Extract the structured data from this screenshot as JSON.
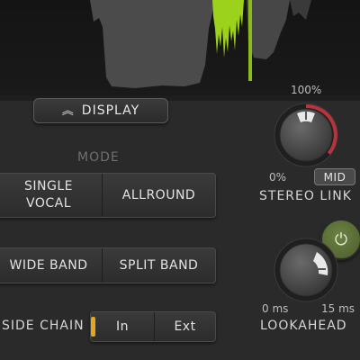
{
  "display": {
    "label": "DISPLAY",
    "icon": "double-chevron-up-icon"
  },
  "mode": {
    "title": "MODE",
    "options": [
      "SINGLE\nVOCAL",
      "ALLROUND"
    ]
  },
  "band": {
    "options": [
      "WIDE BAND",
      "SPLIT BAND"
    ]
  },
  "side_chain": {
    "label": "SIDE CHAIN",
    "options": [
      "In",
      "Ext"
    ],
    "selected": "In"
  },
  "stereo_link": {
    "max_label": "100%",
    "min_label": "0%",
    "mid_label": "MID",
    "label": "STEREO LINK",
    "value_fraction": 0.5
  },
  "lookahead": {
    "min_label": "0 ms",
    "max_label": "15 ms",
    "label": "LOOKAHEAD",
    "value_fraction": 1.0,
    "power_icon": "power-icon"
  },
  "colors": {
    "accent_green": "#9dd21c",
    "indicator_yellow": "#e0a81a",
    "link_red": "#b8343c",
    "power_green": "#5c7035"
  }
}
